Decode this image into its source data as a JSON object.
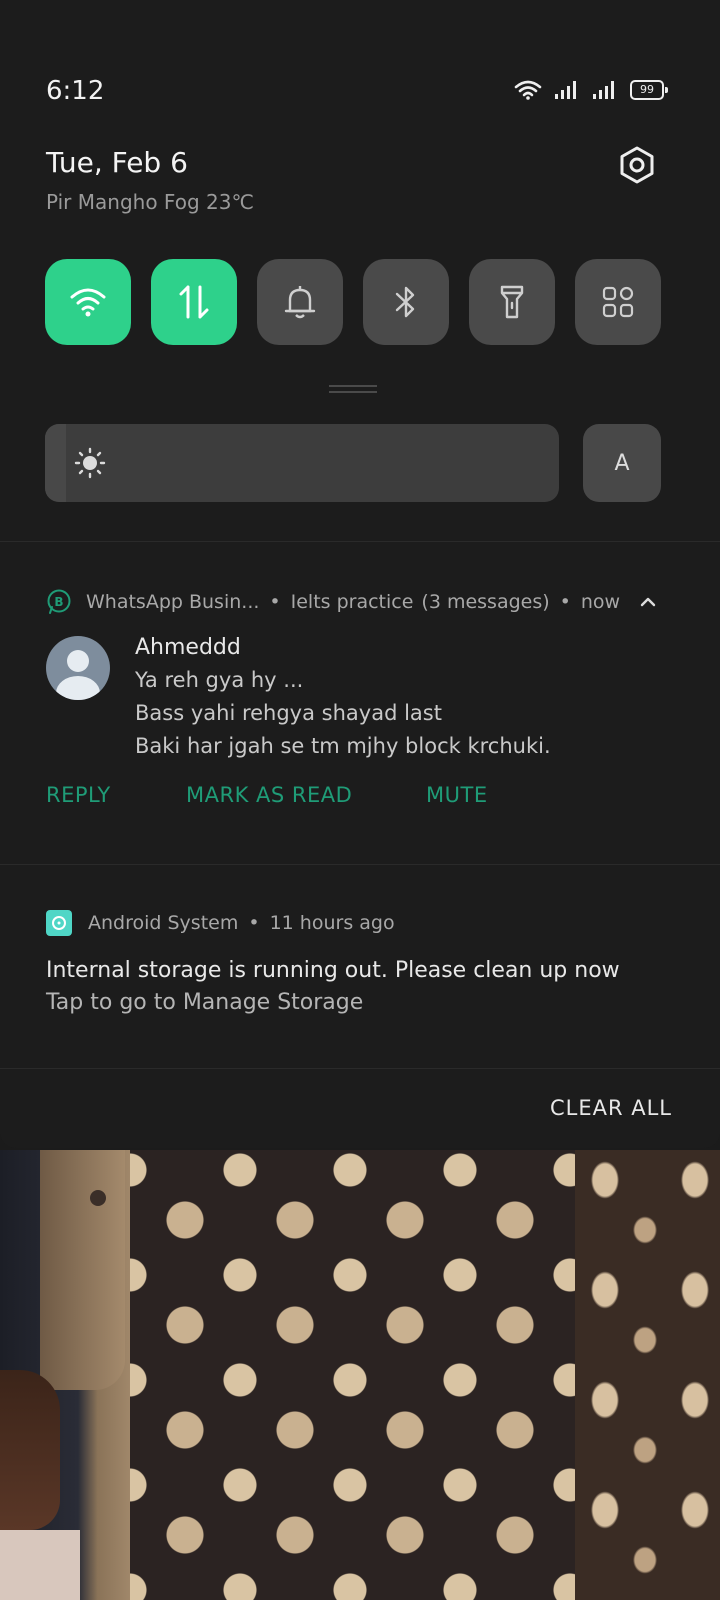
{
  "status_bar": {
    "time": "6:12",
    "battery": "99",
    "icons": [
      "wifi-icon",
      "signal-icon",
      "signal-icon",
      "battery-icon"
    ]
  },
  "header": {
    "date": "Tue, Feb 6",
    "weather": "Pir Mangho Fog 23℃"
  },
  "quick_toggles": [
    {
      "name": "wifi",
      "icon": "wifi-icon",
      "on": true
    },
    {
      "name": "mobile-data",
      "icon": "data-arrows-icon",
      "on": true
    },
    {
      "name": "sound",
      "icon": "bell-icon",
      "on": false
    },
    {
      "name": "bluetooth",
      "icon": "bluetooth-icon",
      "on": false
    },
    {
      "name": "flashlight",
      "icon": "flashlight-icon",
      "on": false
    },
    {
      "name": "more",
      "icon": "grid-icon",
      "on": false
    }
  ],
  "brightness": {
    "level": 0.04,
    "auto_label": "A"
  },
  "whatsapp_notification": {
    "app": "WhatsApp Busin...",
    "conversation": "Ielts practice",
    "count": "(3 messages)",
    "time": "now",
    "sender": "Ahmeddd",
    "messages": [
      "Ya reh gya hy ...",
      "Bass yahi rehgya shayad last",
      "Baki har jgah se tm mjhy block krchuki."
    ],
    "actions": [
      "REPLY",
      "MARK AS READ",
      "MUTE"
    ],
    "accent": "#1f9c77"
  },
  "system_notification": {
    "app": "Android System",
    "time": "11 hours ago",
    "title": "Internal storage is running out. Please clean up now",
    "subtitle": "Tap to go to Manage Storage"
  },
  "footer": {
    "clear_all": "CLEAR ALL"
  },
  "colors": {
    "toggle_on": "#2ed18b",
    "toggle_off": "#4a4a4a",
    "panel": "#1c1c1c"
  }
}
